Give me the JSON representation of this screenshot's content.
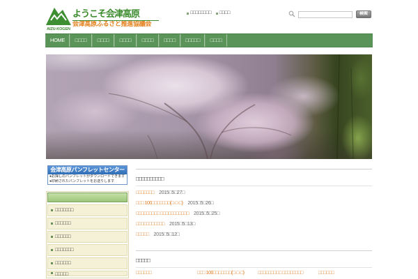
{
  "header": {
    "logo_text": "AIZU-KOGEN",
    "title": "ようこそ会津高原",
    "subtitle": "会津高原ふるさと推進協議会",
    "top_links": [
      "□□□□□□□□",
      "□□□□"
    ],
    "search": {
      "value": "",
      "button_label": "検索"
    }
  },
  "nav": {
    "items": [
      "HOME",
      "□□□□",
      "□□□□",
      "□□□□",
      "□□□□",
      "□□□□",
      "□□□□□",
      "□□□□"
    ]
  },
  "sidebar": {
    "banner": {
      "title": "会津高原パンフレットセンター",
      "lines": [
        "●お探しのパンフレットがダウンロードできます",
        "●印刷されたパンフレットをお送りします"
      ]
    },
    "menu": [
      "□□□□□□□",
      "□□□□□□",
      "□□□□□□",
      "□□□□□□□",
      "□□□□□□",
      "□□□□□"
    ]
  },
  "main": {
    "news_heading": "□□□□□□□□□□",
    "news": [
      {
        "title": "□□□□□□□",
        "date": "2015□5□27□"
      },
      {
        "title": "□□□ 100□□□□□□□(□·□·□)",
        "date": "2015□5□26□"
      },
      {
        "title": "□□□□□□□□□ □□□□□□□□□□□",
        "date": "2015□5□25□"
      },
      {
        "title": "□□□□□□□□□□□",
        "date": "2015□5□13□"
      },
      {
        "title": "□□□□□",
        "date": "2015□5□12□"
      }
    ],
    "section_heading": "□□□□□",
    "columns": [
      "□□□□□□",
      "□□□ 100□□□□□□□(□·□·□)",
      "□□□□□□□□□ □□□□□□□□",
      "□□□□□□"
    ]
  },
  "colors": {
    "nav_bg": "#5b9458",
    "title_green": "#3b8a2c",
    "subtitle_orange": "#e3801c",
    "link_orange": "#de7b22",
    "date_gray": "#666666",
    "banner_blue": "#2f6db5",
    "menu_header_green": "#9cc77a",
    "menu_item_bg": "#f4f1d6"
  },
  "icons": {
    "logo": "mountain-logo-icon",
    "search": "search-icon",
    "bullet": "square-bullet-icon"
  }
}
